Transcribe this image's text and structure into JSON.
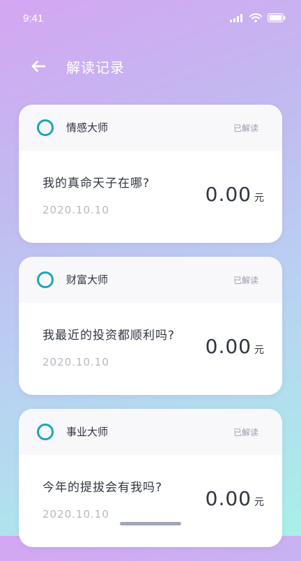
{
  "status_bar": {
    "time": "9:41",
    "icons": [
      "signal-icon",
      "wifi-icon",
      "battery-icon"
    ]
  },
  "header": {
    "back_icon": "arrow-left-icon",
    "title": "解读记录"
  },
  "records": [
    {
      "master": "情感大师",
      "status": "已解读",
      "question": "我的真命天子在哪?",
      "date": "2020.10.10",
      "amount": "0.00",
      "unit": "元"
    },
    {
      "master": "财富大师",
      "status": "已解读",
      "question": "我最近的投资都顺利吗?",
      "date": "2020.10.10",
      "amount": "0.00",
      "unit": "元"
    },
    {
      "master": "事业大师",
      "status": "已解读",
      "question": "今年的提拔会有我吗?",
      "date": "2020.10.10",
      "amount": "0.00",
      "unit": "元"
    }
  ],
  "colors": {
    "accent": "#1aa4b8",
    "text_primary": "#2f3440",
    "text_muted": "#b6b8c2",
    "badge": "#9a9ca6"
  }
}
